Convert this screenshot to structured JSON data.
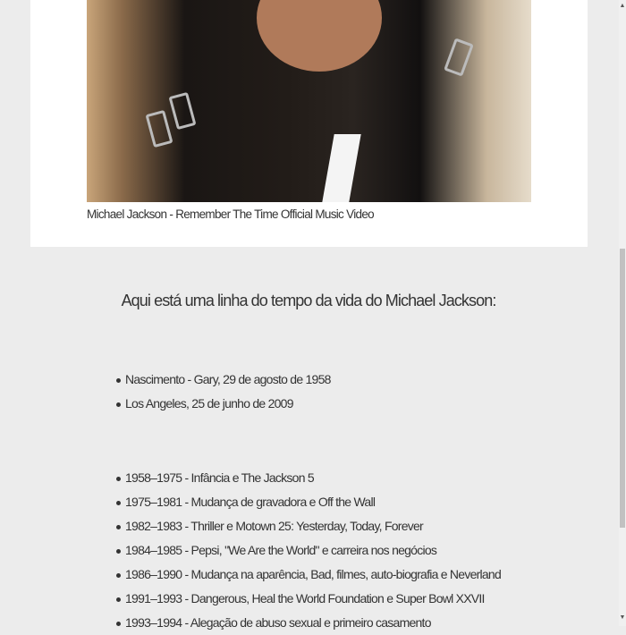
{
  "video": {
    "caption": "Michael Jackson - Remember The Time Official Music Video"
  },
  "timeline": {
    "heading": "Aqui está uma linha do tempo da vida do Michael Jackson:",
    "life": [
      "Nascimento - Gary, 29 de agosto de 1958",
      "Los Angeles, 25 de junho de 2009"
    ],
    "periods": [
      "1958–1975 - Infância e The Jackson 5",
      "1975–1981 - Mudança de gravadora e Off the Wall",
      "1982–1983 - Thriller e Motown 25: Yesterday, Today, Forever",
      "1984–1985 - Pepsi, \"We Are the World\" e carreira nos negócios",
      "1986–1990 - Mudança na aparência, Bad, filmes, auto-biografia e Neverland",
      "1991–1993 - Dangerous, Heal the World Foundation e Super Bowl XXVII",
      "1993–1994 - Alegação de abuso sexual e primeiro casamento"
    ]
  },
  "scrollbar": {
    "up_icon": "▲",
    "down_icon": "▼",
    "position_fraction": 0.4
  }
}
